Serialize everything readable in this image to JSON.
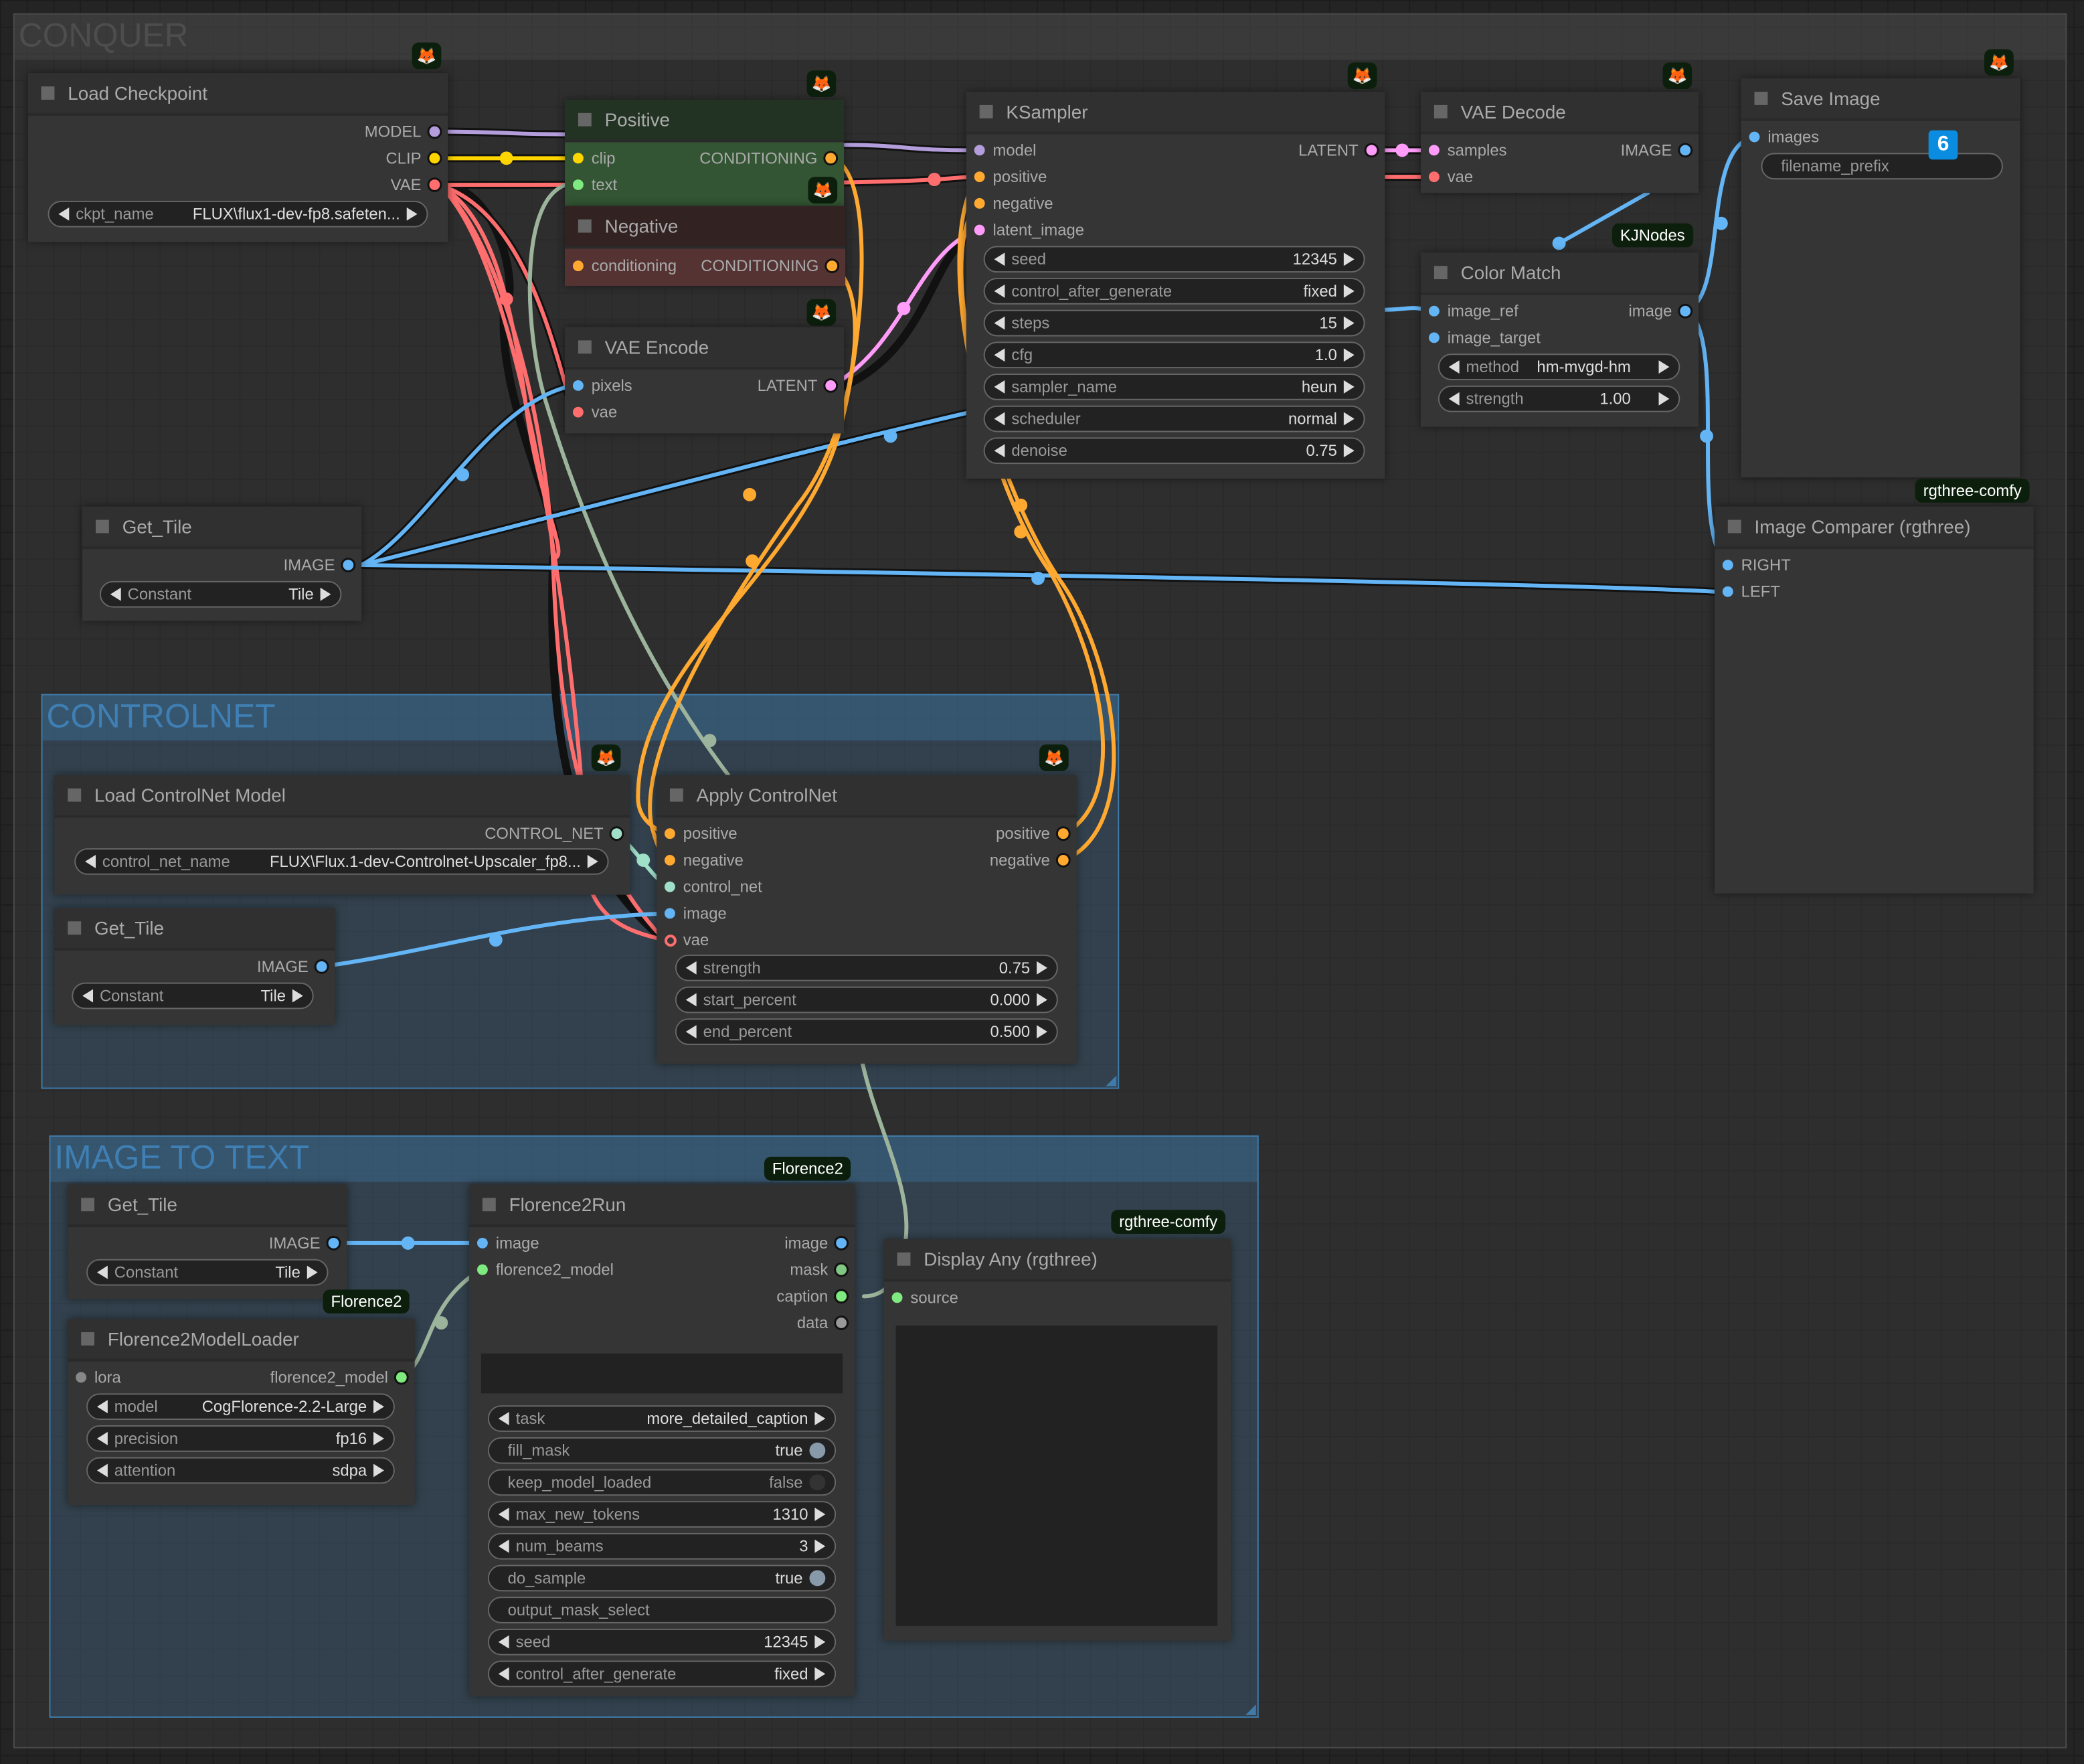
{
  "groups": {
    "conquer": "CONQUER",
    "controlnet": "CONTROLNET",
    "image_to_text": "IMAGE TO TEXT"
  },
  "colors": {
    "model": "#b39ddb",
    "clip": "#ffd500",
    "vae": "#ff6e6e",
    "image": "#64b5f6",
    "conditioning": "#ffa931",
    "latent": "#ff9cf9",
    "control_net": "#a0e0c8",
    "string": "#9cb39c",
    "text_input": "#7fea7f"
  },
  "badges": {
    "fox": "🦊",
    "kjnodes": "KJNodes",
    "rgthree": "rgthree-comfy",
    "florence2": "Florence2",
    "florence2_partial": "Florence2",
    "queue_number": "6"
  },
  "nodes": {
    "load_checkpoint": {
      "title": "Load Checkpoint",
      "outputs": [
        "MODEL",
        "CLIP",
        "VAE"
      ],
      "widget": {
        "label": "ckpt_name",
        "value": "FLUX\\flux1-dev-fp8.safeten..."
      }
    },
    "positive": {
      "title": "Positive",
      "inputs": [
        "clip",
        "text"
      ],
      "output": "CONDITIONING"
    },
    "negative": {
      "title": "Negative",
      "input": "conditioning",
      "output": "CONDITIONING"
    },
    "vae_encode": {
      "title": "VAE Encode",
      "inputs": [
        "pixels",
        "vae"
      ],
      "output": "LATENT"
    },
    "ksampler": {
      "title": "KSampler",
      "inputs": [
        "model",
        "positive",
        "negative",
        "latent_image"
      ],
      "output": "LATENT",
      "widgets": [
        {
          "label": "seed",
          "value": "12345"
        },
        {
          "label": "control_after_generate",
          "value": "fixed"
        },
        {
          "label": "steps",
          "value": "15"
        },
        {
          "label": "cfg",
          "value": "1.0"
        },
        {
          "label": "sampler_name",
          "value": "heun"
        },
        {
          "label": "scheduler",
          "value": "normal"
        },
        {
          "label": "denoise",
          "value": "0.75"
        }
      ]
    },
    "vae_decode": {
      "title": "VAE Decode",
      "inputs": [
        "samples",
        "vae"
      ],
      "output": "IMAGE"
    },
    "color_match": {
      "title": "Color Match",
      "inputs": [
        "image_ref",
        "image_target"
      ],
      "output": "image",
      "widgets": [
        {
          "label": "method",
          "value": "hm-mvgd-hm"
        },
        {
          "label": "strength",
          "value": "1.00"
        }
      ]
    },
    "save_image": {
      "title": "Save Image",
      "input": "images",
      "widget": {
        "label": "filename_prefix",
        "value": ""
      }
    },
    "image_comparer": {
      "title": "Image Comparer (rgthree)",
      "inputs": [
        "RIGHT",
        "LEFT"
      ]
    },
    "get_tile_1": {
      "title": "Get_Tile",
      "output": "IMAGE",
      "widget": {
        "label": "Constant",
        "value": "Tile"
      }
    },
    "load_controlnet": {
      "title": "Load ControlNet Model",
      "output": "CONTROL_NET",
      "widget": {
        "label": "control_net_name",
        "value": "FLUX\\Flux.1-dev-Controlnet-Upscaler_fp8..."
      }
    },
    "get_tile_2": {
      "title": "Get_Tile",
      "output": "IMAGE",
      "widget": {
        "label": "Constant",
        "value": "Tile"
      }
    },
    "apply_controlnet": {
      "title": "Apply ControlNet",
      "inputs": [
        "positive",
        "negative",
        "control_net",
        "image",
        "vae"
      ],
      "outputs": [
        "positive",
        "negative"
      ],
      "widgets": [
        {
          "label": "strength",
          "value": "0.75"
        },
        {
          "label": "start_percent",
          "value": "0.000"
        },
        {
          "label": "end_percent",
          "value": "0.500"
        }
      ]
    },
    "get_tile_3": {
      "title": "Get_Tile",
      "output": "IMAGE",
      "widget": {
        "label": "Constant",
        "value": "Tile"
      }
    },
    "florence2_model_loader": {
      "title": "Florence2ModelLoader",
      "input": "lora",
      "output": "florence2_model",
      "widgets": [
        {
          "label": "model",
          "value": "CogFlorence-2.2-Large"
        },
        {
          "label": "precision",
          "value": "fp16"
        },
        {
          "label": "attention",
          "value": "sdpa"
        }
      ]
    },
    "florence2_run": {
      "title": "Florence2Run",
      "inputs": [
        "image",
        "florence2_model"
      ],
      "outputs": [
        "image",
        "mask",
        "caption",
        "data"
      ],
      "widgets": [
        {
          "label": "task",
          "value": "more_detailed_caption"
        },
        {
          "label": "fill_mask",
          "value": "true"
        },
        {
          "label": "keep_model_loaded",
          "value": "false"
        },
        {
          "label": "max_new_tokens",
          "value": "1310"
        },
        {
          "label": "num_beams",
          "value": "3"
        },
        {
          "label": "do_sample",
          "value": "true"
        },
        {
          "label": "output_mask_select",
          "value": ""
        },
        {
          "label": "seed",
          "value": "12345"
        },
        {
          "label": "control_after_generate",
          "value": "fixed"
        }
      ]
    },
    "display_any": {
      "title": "Display Any (rgthree)",
      "input": "source"
    }
  }
}
